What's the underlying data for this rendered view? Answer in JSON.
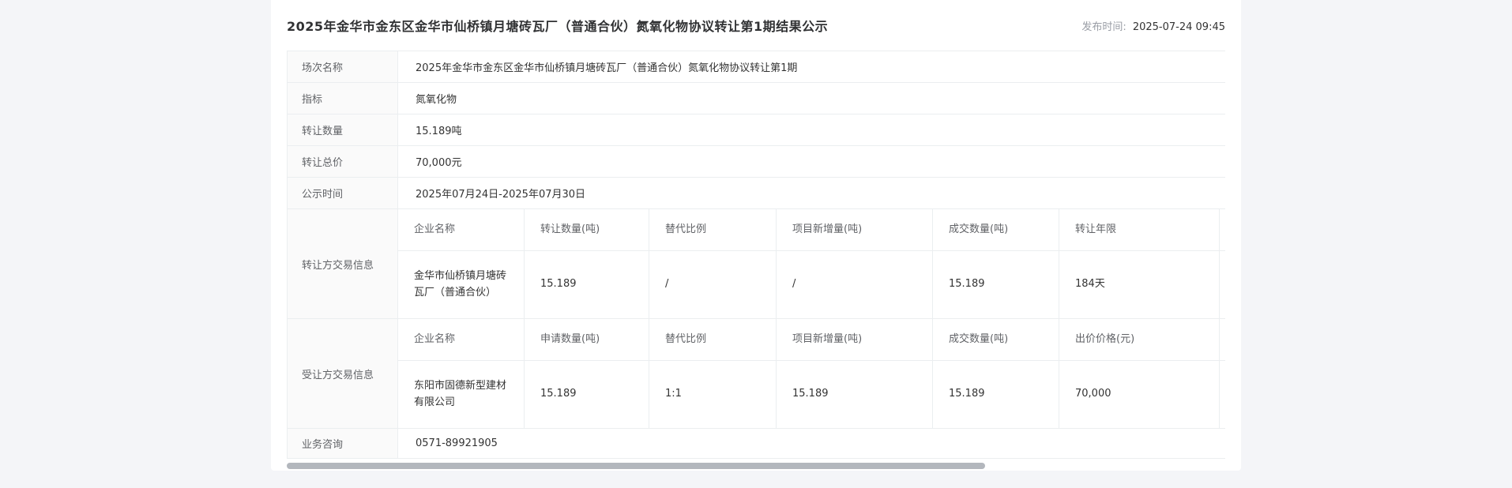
{
  "page": {
    "title": "2025年金华市金东区金华市仙桥镇月塘砖瓦厂（普通合伙）氮氧化物协议转让第1期结果公示",
    "publish_label": "发布时间:",
    "publish_time": "2025-07-24 09:45"
  },
  "info_rows": [
    {
      "label": "场次名称",
      "value": "2025年金华市金东区金华市仙桥镇月塘砖瓦厂（普通合伙）氮氧化物协议转让第1期"
    },
    {
      "label": "指标",
      "value": "氮氧化物"
    },
    {
      "label": "转让数量",
      "value": "15.189吨"
    },
    {
      "label": "转让总价",
      "value": "70,000元"
    },
    {
      "label": "公示时间",
      "value": "2025年07月24日-2025年07月30日"
    }
  ],
  "transferor_section": {
    "label": "转让方交易信息",
    "columns": [
      "企业名称",
      "转让数量(吨)",
      "替代比例",
      "项目新增量(吨)",
      "成交数量(吨)",
      "转让年限"
    ],
    "rows": [
      [
        "金华市仙桥镇月塘砖瓦厂（普通合伙）",
        "15.189",
        "/",
        "/",
        "15.189",
        "184天"
      ]
    ]
  },
  "transferee_section": {
    "label": "受让方交易信息",
    "columns": [
      "企业名称",
      "申请数量(吨)",
      "替代比例",
      "项目新增量(吨)",
      "成交数量(吨)",
      "出价价格(元)"
    ],
    "rows": [
      [
        "东阳市固德新型建材有限公司",
        "15.189",
        "1:1",
        "15.189",
        "15.189",
        "70,000"
      ]
    ]
  },
  "footer_row": {
    "label": "业务咨询",
    "value": "0571-89921905"
  }
}
